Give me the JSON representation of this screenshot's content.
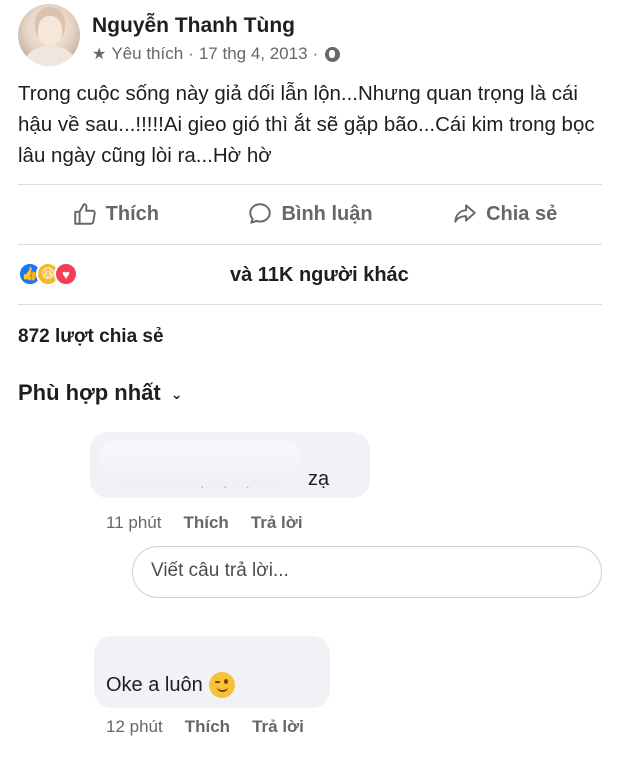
{
  "post": {
    "author": "Nguyễn Thanh Tùng",
    "meta_favorite": "Yêu thích",
    "meta_separator": "·",
    "meta_date": "17 thg 4, 2013",
    "meta_separator2": "·",
    "text": "Trong cuộc sống này giả dối lẫn lộn...Nhưng quan trọng là cái hậu về sau...!!!!!Ai gieo gió thì ắt sẽ gặp bão...Cái kim trong bọc lâu ngày cũng lòi ra...Hờ hờ"
  },
  "actions": {
    "like_label": "Thích",
    "comment_label": "Bình luận",
    "share_label": "Chia sẻ"
  },
  "reactions": {
    "icons": [
      "like-icon",
      "haha-icon",
      "love-icon"
    ],
    "summary": "và 11K người khác"
  },
  "shares": {
    "count_text": "872 lượt chia sẻ"
  },
  "sort": {
    "label": "Phù hợp nhất"
  },
  "comments": [
    {
      "text": "zạ",
      "time": "11 phút",
      "like_label": "Thích",
      "reply_label": "Trả lời"
    },
    {
      "text": "Oke a luôn",
      "time": "12 phút",
      "like_label": "Thích",
      "reply_label": "Trả lời"
    }
  ],
  "reply_box": {
    "placeholder": "Viết câu trả lời..."
  },
  "colors": {
    "text_primary": "#1c1e21",
    "text_secondary": "#65676b",
    "bubble": "#f0f2f5",
    "like_blue": "#1877f2",
    "haha_yellow": "#f7b928",
    "love_red": "#f33e58"
  }
}
